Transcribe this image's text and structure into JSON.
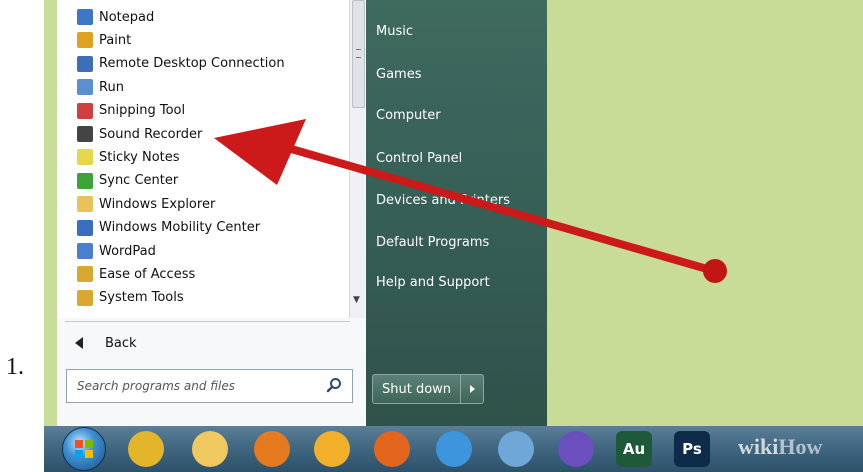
{
  "step_number": "1.",
  "programs": [
    {
      "label": "Notepad",
      "icon": "notepad-icon",
      "color": "#3b77c4"
    },
    {
      "label": "Paint",
      "icon": "paint-icon",
      "color": "#e0a020"
    },
    {
      "label": "Remote Desktop Connection",
      "icon": "remote-desktop-icon",
      "color": "#3d6fb8"
    },
    {
      "label": "Run",
      "icon": "run-icon",
      "color": "#5a8fd0"
    },
    {
      "label": "Snipping Tool",
      "icon": "snipping-tool-icon",
      "color": "#d04040"
    },
    {
      "label": "Sound Recorder",
      "icon": "microphone-icon",
      "color": "#444444"
    },
    {
      "label": "Sticky Notes",
      "icon": "sticky-notes-icon",
      "color": "#e6d84a"
    },
    {
      "label": "Sync Center",
      "icon": "sync-center-icon",
      "color": "#3aa43a"
    },
    {
      "label": "Windows Explorer",
      "icon": "folder-icon",
      "color": "#e8c25a"
    },
    {
      "label": "Windows Mobility Center",
      "icon": "mobility-center-icon",
      "color": "#3a6fc0"
    },
    {
      "label": "WordPad",
      "icon": "wordpad-icon",
      "color": "#4a7fd0"
    },
    {
      "label": "Ease of Access",
      "icon": "folder-icon",
      "color": "#d8a830"
    },
    {
      "label": "System Tools",
      "icon": "folder-icon",
      "color": "#d8a830"
    }
  ],
  "back_label": "Back",
  "search": {
    "placeholder": "Search programs and files"
  },
  "right_items": [
    {
      "label": "Music"
    },
    {
      "label": "Games"
    },
    {
      "label": "Computer"
    },
    {
      "label": "Control Panel"
    },
    {
      "label": "Devices and Printers"
    },
    {
      "label": "Default Programs"
    },
    {
      "label": "Help and Support"
    }
  ],
  "shutdown_label": "Shut down",
  "taskbar_icons": [
    {
      "name": "chrome-icon",
      "color": "#e3b52a"
    },
    {
      "name": "folder-icon",
      "color": "#f0c860"
    },
    {
      "name": "media-player-icon",
      "color": "#e67a1e"
    },
    {
      "name": "app-icon",
      "color": "#f2b02a"
    },
    {
      "name": "firefox-icon",
      "color": "#e4651c"
    },
    {
      "name": "internet-explorer-icon",
      "color": "#3d95dd"
    },
    {
      "name": "safari-icon",
      "color": "#6fa8d8"
    },
    {
      "name": "messenger-icon",
      "color": "#6b4fbf"
    },
    {
      "name": "audition-icon",
      "color": "#1e5a3a",
      "text": "Au"
    },
    {
      "name": "photoshop-icon",
      "color": "#0f2b4a",
      "text": "Ps"
    }
  ],
  "watermark": {
    "wiki": "wiki",
    "how": "How"
  },
  "colors": {
    "arrow": "#cc1a1a",
    "desktop": "#c8dc98",
    "panel": "#3f6a5e"
  }
}
